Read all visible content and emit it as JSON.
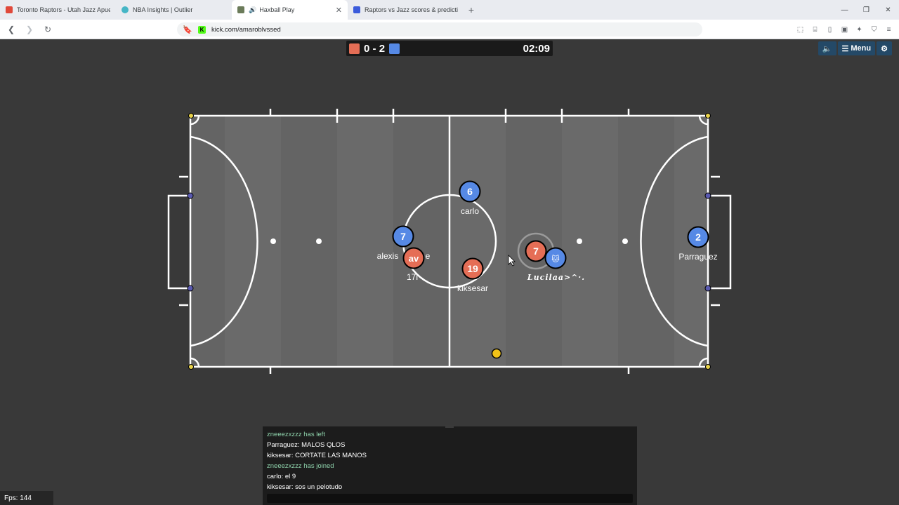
{
  "browser": {
    "tabs": [
      {
        "title": "Toronto Raptors - Utah Jazz Apuesta:",
        "color": "#e0483a",
        "active": false
      },
      {
        "title": "NBA Insights | Outlier",
        "color": "#46b6c6",
        "active": false
      },
      {
        "title": "Haxball Play",
        "color": "#6b7b5a",
        "active": true
      },
      {
        "title": "Raptors vs Jazz scores & predictions",
        "color": "#3b5bdb",
        "active": false
      }
    ],
    "new_tab": "+",
    "url": "kick.com/amaroblvssed"
  },
  "scoreboard": {
    "red_score": "0",
    "separator": "-",
    "blue_score": "2",
    "time": "02:09",
    "red_color": "#e56e56",
    "blue_color": "#5689e5"
  },
  "menu": {
    "sound_icon": "speaker-icon",
    "menu_label": "Menu",
    "settings_icon": "gear-icon"
  },
  "players": [
    {
      "name": "carlo",
      "number": "6",
      "team": "blue"
    },
    {
      "name": "alexis",
      "name_suffix": "e",
      "number": "7",
      "team": "blue"
    },
    {
      "name": "17i",
      "number": "av",
      "team": "red"
    },
    {
      "name": "kiksesar",
      "number": "19",
      "team": "red"
    },
    {
      "name": "",
      "number": "7",
      "team": "red"
    },
    {
      "name": "Lucilaa>^·.",
      "number": "🐱",
      "team": "blue"
    },
    {
      "name": "Parraguez",
      "number": "2",
      "team": "blue"
    }
  ],
  "chat": {
    "messages": [
      {
        "text": "zneeezxzzz has left",
        "system": true
      },
      {
        "text": "Parraguez: MALOS QLOS",
        "system": false
      },
      {
        "text": "kiksesar: CORTATE LAS MANOS",
        "system": false
      },
      {
        "text": "zneeezxzzz has joined",
        "system": true
      },
      {
        "text": "carlo: el 9",
        "system": false
      },
      {
        "text": "kiksesar: sos un pelotudo",
        "system": false
      }
    ]
  },
  "fps": "Fps: 144"
}
